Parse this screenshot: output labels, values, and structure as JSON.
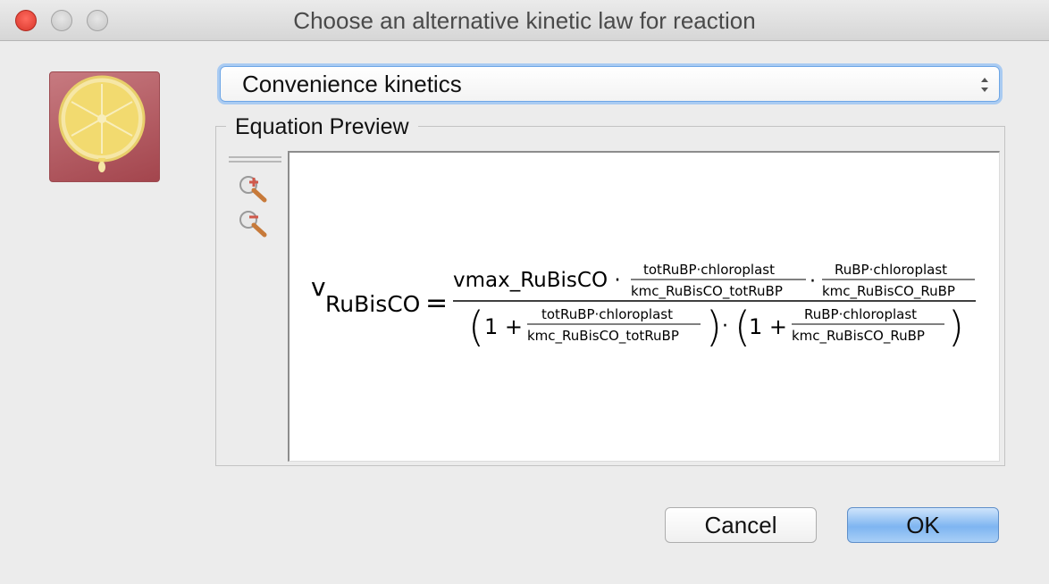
{
  "window": {
    "title": "Choose an alternative kinetic law for reaction"
  },
  "kinetic_law_select": {
    "selected": "Convenience kinetics"
  },
  "equation_preview": {
    "legend": "Equation Preview",
    "lhs": "v",
    "lhs_subscript": "RuBisCO",
    "equals": "=",
    "numerator_factor": "vmax_RuBisCO ·",
    "frac1_num": "totRuBP·chloroplast",
    "frac1_den": "kmc_RuBisCO_totRuBP",
    "dot": "·",
    "frac2_num": "RuBP·chloroplast",
    "frac2_den": "kmc_RuBisCO_RuBP",
    "den_one": "1 +",
    "den_frac1_num": "totRuBP·chloroplast",
    "den_frac1_den": "kmc_RuBisCO_totRuBP",
    "den_frac2_num": "RuBP·chloroplast",
    "den_frac2_den": "kmc_RuBisCO_RuBP"
  },
  "buttons": {
    "cancel": "Cancel",
    "ok": "OK"
  }
}
